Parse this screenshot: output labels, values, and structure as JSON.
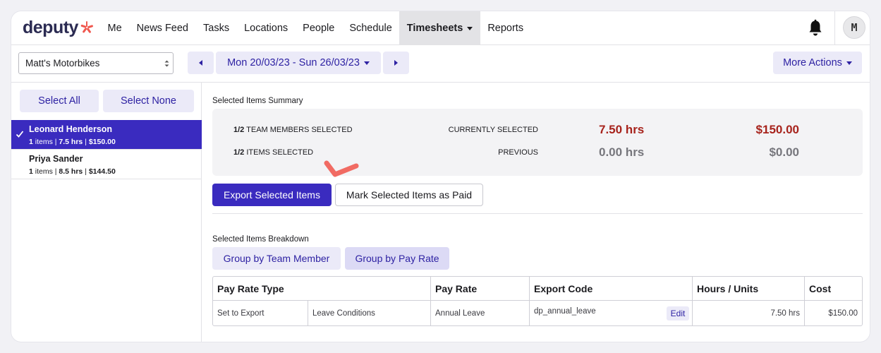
{
  "brand": {
    "logo_text": "deputy",
    "logo_color": "#2b2b52",
    "logo_mark_color": "#f0584f",
    "accent_color": "#3a2bbf",
    "soft_accent_color": "#ebeaf8",
    "money_color": "#a7231c"
  },
  "nav": {
    "items": [
      {
        "label": "Me"
      },
      {
        "label": "News Feed"
      },
      {
        "label": "Tasks"
      },
      {
        "label": "Locations"
      },
      {
        "label": "People"
      },
      {
        "label": "Schedule"
      },
      {
        "label": "Timesheets",
        "active": true,
        "has_dropdown": true
      },
      {
        "label": "Reports"
      }
    ],
    "bell_icon": "bell-icon",
    "avatar_initial": "M"
  },
  "toolbar": {
    "location_value": "Matt's Motorbikes",
    "date_range": "Mon 20/03/23 - Sun 26/03/23",
    "more_actions_label": "More Actions"
  },
  "sidebar": {
    "select_all_label": "Select All",
    "select_none_label": "Select None",
    "members": [
      {
        "name": "Leonard Henderson",
        "count": "1",
        "items_text": " items | ",
        "hours": "7.5 hrs",
        "sep": " | ",
        "amount": "$150.00",
        "selected": true
      },
      {
        "name": "Priya Sander",
        "count": "1",
        "items_text": " items | ",
        "hours": "8.5 hrs",
        "sep": " | ",
        "amount": "$144.50",
        "selected": false
      }
    ]
  },
  "summary": {
    "title": "Selected Items Summary",
    "team_members_count": "1/2",
    "team_members_label": " TEAM MEMBERS SELECTED",
    "items_count": "1/2",
    "items_label": " ITEMS SELECTED",
    "current_label": "CURRENTLY SELECTED",
    "current_hours": "7.50 hrs",
    "current_amount": "$150.00",
    "previous_label": "PREVIOUS",
    "previous_hours": "0.00 hrs",
    "previous_amount": "$0.00"
  },
  "actions": {
    "export_label": "Export Selected Items",
    "mark_paid_label": "Mark Selected Items as Paid"
  },
  "breakdown": {
    "title": "Selected Items Breakdown",
    "group_by_member_label": "Group by Team Member",
    "group_by_rate_label": "Group by Pay Rate",
    "headers": [
      "Pay Rate Type",
      "Pay Rate",
      "Export Code",
      "Hours / Units",
      "Cost"
    ],
    "rows": [
      {
        "set_to_export": "Set to Export",
        "type": "Leave Conditions",
        "pay_rate": "Annual Leave",
        "export_code": "dp_annual_leave",
        "edit_label": "Edit",
        "hours": "7.50 hrs",
        "cost": "$150.00"
      }
    ]
  }
}
